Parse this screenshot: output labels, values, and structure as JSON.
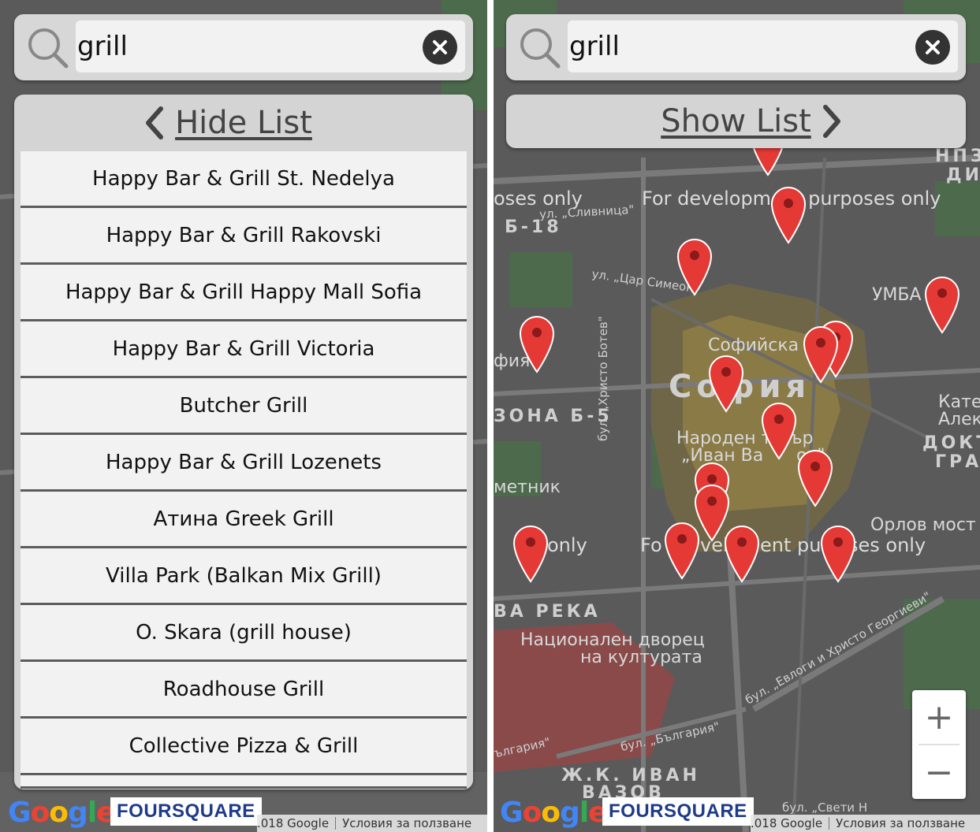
{
  "search": {
    "query": "grill"
  },
  "left_panel": {
    "toggle_label": "Hide List",
    "results": [
      "Happy Bar & Grill St. Nedelya",
      "Happy Bar & Grill Rakovski",
      "Happy Bar & Grill Happy Mall Sofia",
      "Happy Bar & Grill Victoria",
      "Butcher Grill",
      "Happy Bar & Grill Lozenets",
      "Атина Greek Grill",
      "Villa Park (Balkan Mix Grill)",
      "O. Skara (grill house)",
      "Roadhouse Grill",
      "Collective Pizza & Grill"
    ]
  },
  "right_panel": {
    "toggle_label": "Show List"
  },
  "map": {
    "labels": {
      "dev1": "For development purposes only",
      "dev_left": "oses only",
      "dev2a": "Fo",
      "dev2b": "vel",
      "dev2c": "ent pu",
      "dev2d": "ses only",
      "dev2e": "only",
      "b18": "Б-18",
      "slivnitsa": "ул. „Сливница\"",
      "tsar": "ул. „Цар Симеон\"",
      "umba": "УМБА",
      "sofiyska": "Софийска с",
      "sofiya": "София",
      "fiya": "фия",
      "zona": "ЗОНА Б-5",
      "botev": "бул. „Христо Ботев\"",
      "theatre1": "Народен те",
      "theatre2": "ър",
      "ivan": "„Иван Ва",
      "ov": "ов\"",
      "kat1": "Кате",
      "kat2": "Алек",
      "dokt1": "ДОКТ",
      "dokt2": "ГРА",
      "metnik": "метник",
      "orlov": "Орлов мост",
      "vareka": "ВА РЕКА",
      "ndk1": "Национален дворец",
      "ndk2": "на културата",
      "evlogi": "бул. „Евлоги и Христо Георгиеви\"",
      "bulgaria": "бул. „България\"",
      "bulgaria2": "ългария\"",
      "zhk1": "Ж.К. ИВАН",
      "zhk2": "ВАЗОВ",
      "npz1": "НПЗ",
      "npz2": "ДИ",
      "svetih": "бул. „Свети Н"
    },
    "attribution": {
      "copyright": ".018 Google",
      "terms": "Условия за ползване",
      "google_logo": "Google",
      "foursquare": "FOURSQUARE"
    },
    "zoom": {
      "in": "+",
      "out": "−"
    }
  },
  "colors": {
    "pin": "#e53935",
    "pin_dot": "#8b1a1a",
    "map_bg": "#5a5a5a",
    "panel_bg": "#d4d4d4",
    "item_bg": "#f2f2f2",
    "highlight": "#b8963a"
  }
}
